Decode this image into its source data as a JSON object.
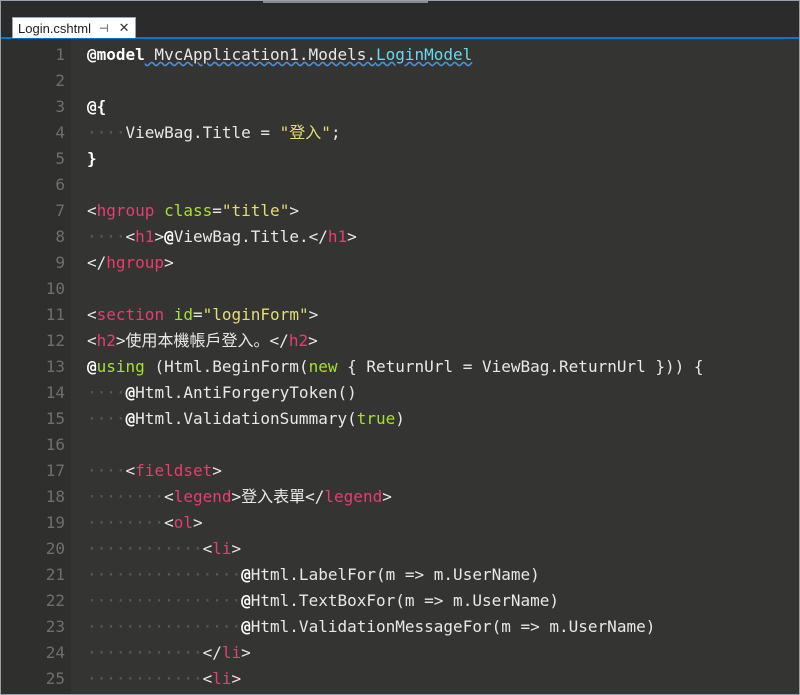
{
  "tab": {
    "title": "Login.cshtml",
    "pin": "⊣",
    "close": "✕"
  },
  "lines": [
    {
      "n": "1",
      "indent": 0,
      "tokens": [
        [
          "razor",
          "@model"
        ],
        [
          "plain",
          " MvcApplication1.Models."
        ],
        [
          "type",
          "LoginModel"
        ]
      ]
    },
    {
      "n": "2",
      "indent": 0,
      "tokens": []
    },
    {
      "n": "3",
      "indent": 0,
      "tokens": [
        [
          "razor",
          "@{"
        ]
      ]
    },
    {
      "n": "4",
      "indent": 1,
      "tokens": [
        [
          "plain",
          "ViewBag.Title = "
        ],
        [
          "str",
          "\"登入\""
        ],
        [
          "plain",
          ";"
        ]
      ]
    },
    {
      "n": "5",
      "indent": 0,
      "tokens": [
        [
          "razor",
          "}"
        ]
      ]
    },
    {
      "n": "6",
      "indent": 0,
      "tokens": []
    },
    {
      "n": "7",
      "indent": 0,
      "tokens": [
        [
          "plain",
          "<"
        ],
        [
          "tag",
          "hgroup"
        ],
        [
          "plain",
          " "
        ],
        [
          "attr",
          "class"
        ],
        [
          "plain",
          "="
        ],
        [
          "str",
          "\"title\""
        ],
        [
          "plain",
          ">"
        ]
      ]
    },
    {
      "n": "8",
      "indent": 1,
      "tokens": [
        [
          "plain",
          "<"
        ],
        [
          "tag",
          "h1"
        ],
        [
          "plain",
          ">"
        ],
        [
          "razor",
          "@"
        ],
        [
          "plain",
          "ViewBag.Title.</"
        ],
        [
          "tag",
          "h1"
        ],
        [
          "plain",
          ">"
        ]
      ]
    },
    {
      "n": "9",
      "indent": 0,
      "tokens": [
        [
          "plain",
          "</"
        ],
        [
          "tag",
          "hgroup"
        ],
        [
          "plain",
          ">"
        ]
      ]
    },
    {
      "n": "10",
      "indent": 0,
      "tokens": []
    },
    {
      "n": "11",
      "indent": 0,
      "tokens": [
        [
          "plain",
          "<"
        ],
        [
          "tag",
          "section"
        ],
        [
          "plain",
          " "
        ],
        [
          "attr",
          "id"
        ],
        [
          "plain",
          "="
        ],
        [
          "str",
          "\"loginForm\""
        ],
        [
          "plain",
          ">"
        ]
      ]
    },
    {
      "n": "12",
      "indent": 0,
      "tokens": [
        [
          "plain",
          "<"
        ],
        [
          "tag",
          "h2"
        ],
        [
          "plain",
          ">使用本機帳戶登入。</"
        ],
        [
          "tag",
          "h2"
        ],
        [
          "plain",
          ">"
        ]
      ]
    },
    {
      "n": "13",
      "indent": 0,
      "tokens": [
        [
          "razor",
          "@"
        ],
        [
          "kw2",
          "using"
        ],
        [
          "plain",
          " (Html.BeginForm("
        ],
        [
          "kw2",
          "new"
        ],
        [
          "plain",
          " { ReturnUrl = ViewBag.ReturnUrl })) {"
        ]
      ]
    },
    {
      "n": "14",
      "indent": 1,
      "tokens": [
        [
          "razor",
          "@"
        ],
        [
          "plain",
          "Html.AntiForgeryToken()"
        ]
      ]
    },
    {
      "n": "15",
      "indent": 1,
      "tokens": [
        [
          "razor",
          "@"
        ],
        [
          "plain",
          "Html.ValidationSummary("
        ],
        [
          "kw2",
          "true"
        ],
        [
          "plain",
          ")"
        ]
      ]
    },
    {
      "n": "16",
      "indent": 0,
      "tokens": []
    },
    {
      "n": "17",
      "indent": 1,
      "tokens": [
        [
          "plain",
          "<"
        ],
        [
          "tag",
          "fieldset"
        ],
        [
          "plain",
          ">"
        ]
      ]
    },
    {
      "n": "18",
      "indent": 2,
      "tokens": [
        [
          "plain",
          "<"
        ],
        [
          "tag",
          "legend"
        ],
        [
          "plain",
          ">登入表單</"
        ],
        [
          "tag",
          "legend"
        ],
        [
          "plain",
          ">"
        ]
      ]
    },
    {
      "n": "19",
      "indent": 2,
      "tokens": [
        [
          "plain",
          "<"
        ],
        [
          "tag",
          "ol"
        ],
        [
          "plain",
          ">"
        ]
      ]
    },
    {
      "n": "20",
      "indent": 3,
      "tokens": [
        [
          "plain",
          "<"
        ],
        [
          "tag",
          "li"
        ],
        [
          "plain",
          ">"
        ]
      ]
    },
    {
      "n": "21",
      "indent": 4,
      "tokens": [
        [
          "razor",
          "@"
        ],
        [
          "plain",
          "Html.LabelFor(m => m.UserName)"
        ]
      ]
    },
    {
      "n": "22",
      "indent": 4,
      "tokens": [
        [
          "razor",
          "@"
        ],
        [
          "plain",
          "Html.TextBoxFor(m => m.UserName)"
        ]
      ]
    },
    {
      "n": "23",
      "indent": 4,
      "tokens": [
        [
          "razor",
          "@"
        ],
        [
          "plain",
          "Html.ValidationMessageFor(m => m.UserName)"
        ]
      ]
    },
    {
      "n": "24",
      "indent": 3,
      "tokens": [
        [
          "plain",
          "</"
        ],
        [
          "tag",
          "li"
        ],
        [
          "plain",
          ">"
        ]
      ]
    },
    {
      "n": "25",
      "indent": 3,
      "tokens": [
        [
          "plain",
          "<"
        ],
        [
          "tag",
          "li"
        ],
        [
          "plain",
          ">"
        ]
      ]
    }
  ]
}
